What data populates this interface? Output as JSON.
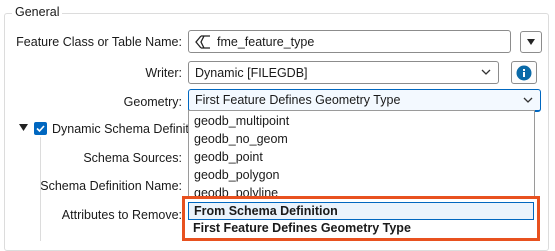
{
  "section_title": "General",
  "feature_class": {
    "label": "Feature Class or Table Name:",
    "value": "fme_feature_type"
  },
  "writer": {
    "label": "Writer:",
    "value": "Dynamic [FILEGDB]"
  },
  "geometry": {
    "label": "Geometry:",
    "value": "First Feature Defines Geometry Type",
    "options": [
      "geodb_multipoint",
      "geodb_no_geom",
      "geodb_point",
      "geodb_polygon",
      "geodb_polyline"
    ],
    "highlighted_options": [
      "From Schema Definition",
      "First Feature Defines Geometry Type"
    ]
  },
  "dynamic_schema": {
    "label": "Dynamic Schema Definiti",
    "checked": true
  },
  "schema_sources": {
    "label": "Schema Sources:"
  },
  "schema_definition_name": {
    "label": "Schema Definition Name:"
  },
  "attributes_to_remove": {
    "label": "Attributes to Remove:"
  },
  "colors": {
    "accent": "#0067c0",
    "highlight_border": "#e8511f",
    "info_icon": "#0a6aa8"
  }
}
